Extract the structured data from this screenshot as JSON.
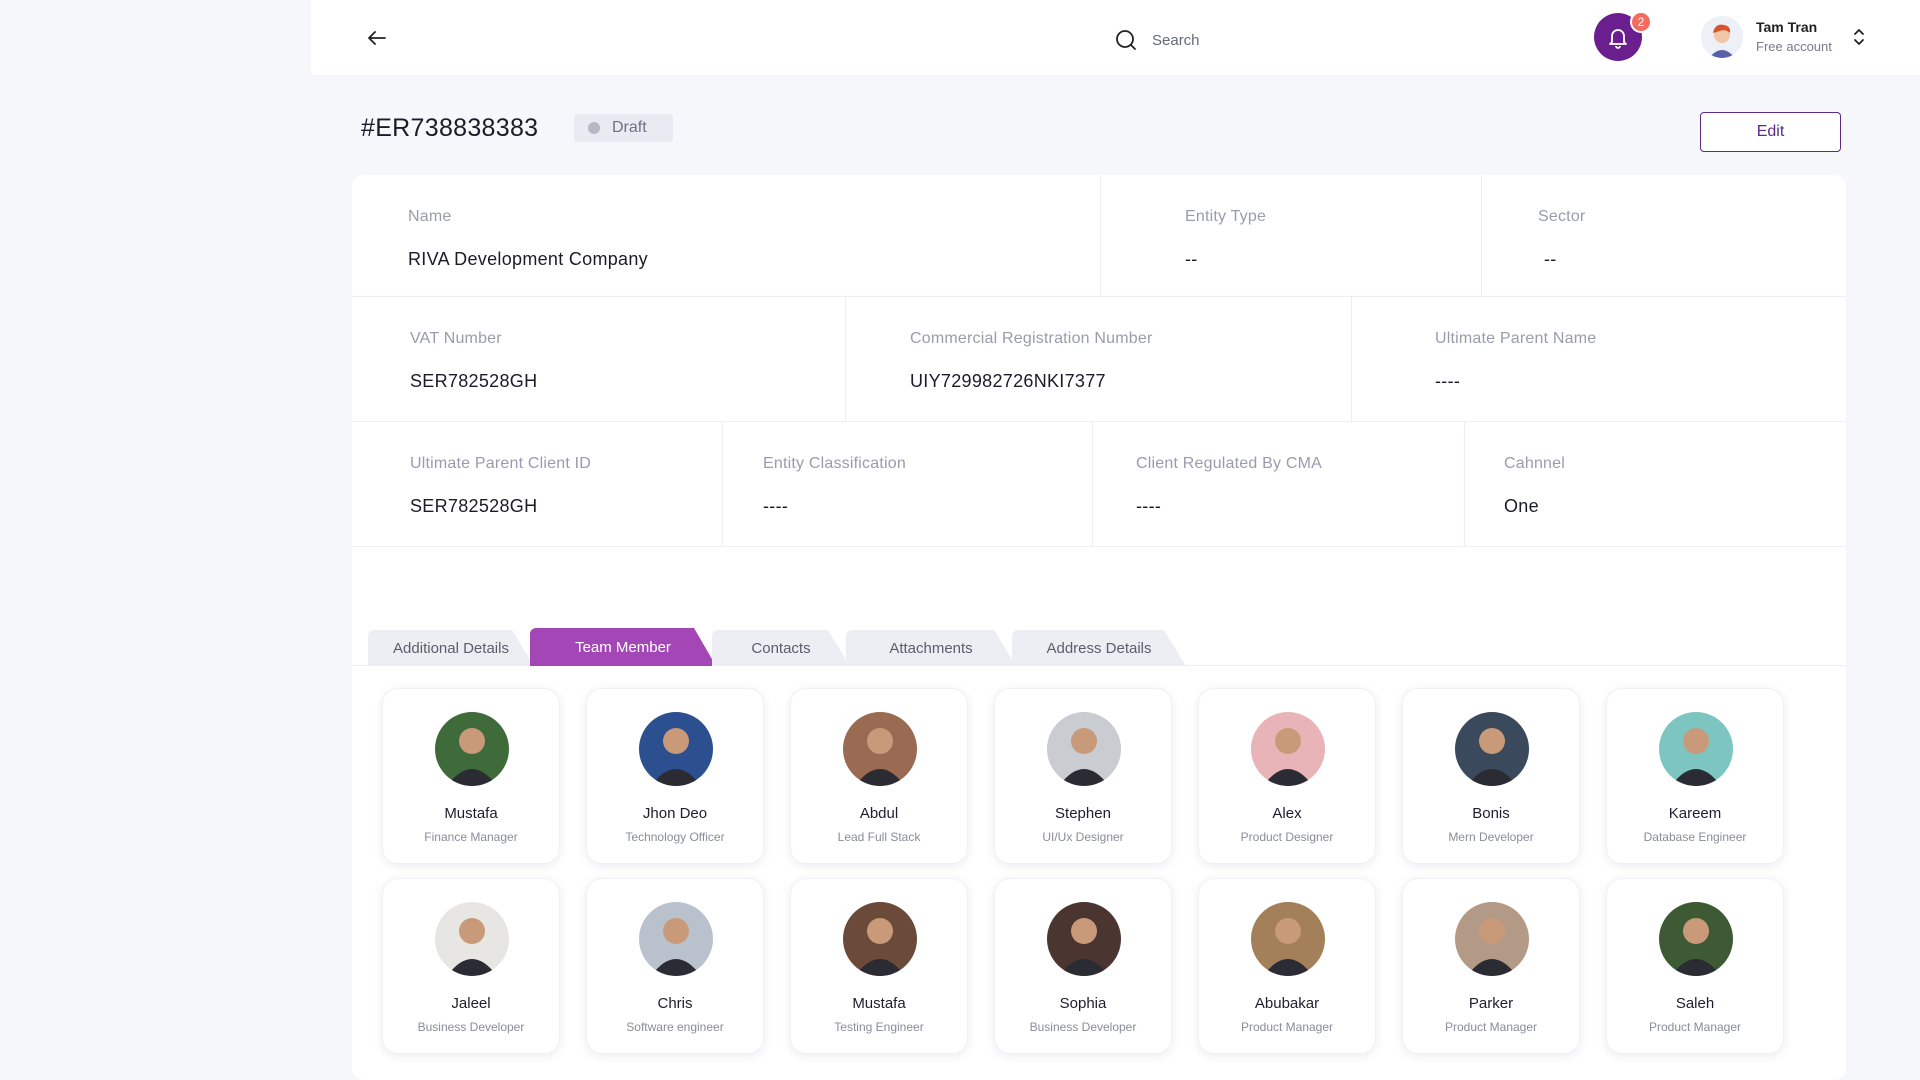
{
  "header": {
    "search_placeholder": "Search",
    "notification_count": "2",
    "user_name": "Tam Tran",
    "user_account": "Free account"
  },
  "record": {
    "id": "#ER738838383",
    "status": "Draft",
    "edit_label": "Edit"
  },
  "fields": {
    "name": {
      "label": "Name",
      "value": "RIVA Development Company"
    },
    "entity_type": {
      "label": "Entity Type",
      "value": "--"
    },
    "sector": {
      "label": "Sector",
      "value": "--"
    },
    "vat": {
      "label": "VAT Number",
      "value": "SER782528GH"
    },
    "crn": {
      "label": "Commercial Registration Number",
      "value": "UIY729982726NKI7377"
    },
    "upn": {
      "label": "Ultimate Parent Name",
      "value": "----"
    },
    "upcid": {
      "label": "Ultimate Parent Client ID",
      "value": "SER782528GH"
    },
    "classification": {
      "label": "Entity Classification",
      "value": "----"
    },
    "cma": {
      "label": "Client Regulated By CMA",
      "value": "----"
    },
    "channel": {
      "label": "Cahnnel",
      "value": "One"
    }
  },
  "tabs": [
    {
      "label": "Additional Details"
    },
    {
      "label": "Team Member"
    },
    {
      "label": "Contacts"
    },
    {
      "label": "Attachments"
    },
    {
      "label": "Address Details"
    }
  ],
  "active_tab": "Team Member",
  "members": [
    {
      "name": "Mustafa",
      "role": "Finance Manager",
      "color": "#3f6b3a"
    },
    {
      "name": "Jhon Deo",
      "role": "Technology Officer",
      "color": "#2c4f8f"
    },
    {
      "name": "Abdul",
      "role": "Lead Full Stack",
      "color": "#9a6a52"
    },
    {
      "name": "Stephen",
      "role": "UI/Ux Designer",
      "color": "#c9ccd1"
    },
    {
      "name": "Alex",
      "role": "Product Designer",
      "color": "#e8b4b8"
    },
    {
      "name": "Bonis",
      "role": "Mern Developer",
      "color": "#3a4a5c"
    },
    {
      "name": "Kareem",
      "role": "Database Engineer",
      "color": "#7cc5c1"
    },
    {
      "name": "Jaleel",
      "role": "Business Developer",
      "color": "#e7e6e3"
    },
    {
      "name": "Chris",
      "role": "Software engineer",
      "color": "#b9c2cc"
    },
    {
      "name": "Mustafa",
      "role": "Testing Engineer",
      "color": "#6b4a3a"
    },
    {
      "name": "Sophia",
      "role": "Business Developer",
      "color": "#4a3530"
    },
    {
      "name": "Abubakar",
      "role": "Product Manager",
      "color": "#a4805a"
    },
    {
      "name": "Parker",
      "role": "Product Manager",
      "color": "#b29a86"
    },
    {
      "name": "Saleh",
      "role": "Product Manager",
      "color": "#3d5a34"
    }
  ],
  "colors": {
    "accent": "#a347b7",
    "brand_dark": "#5a2a86",
    "badge": "#f46a5f"
  }
}
